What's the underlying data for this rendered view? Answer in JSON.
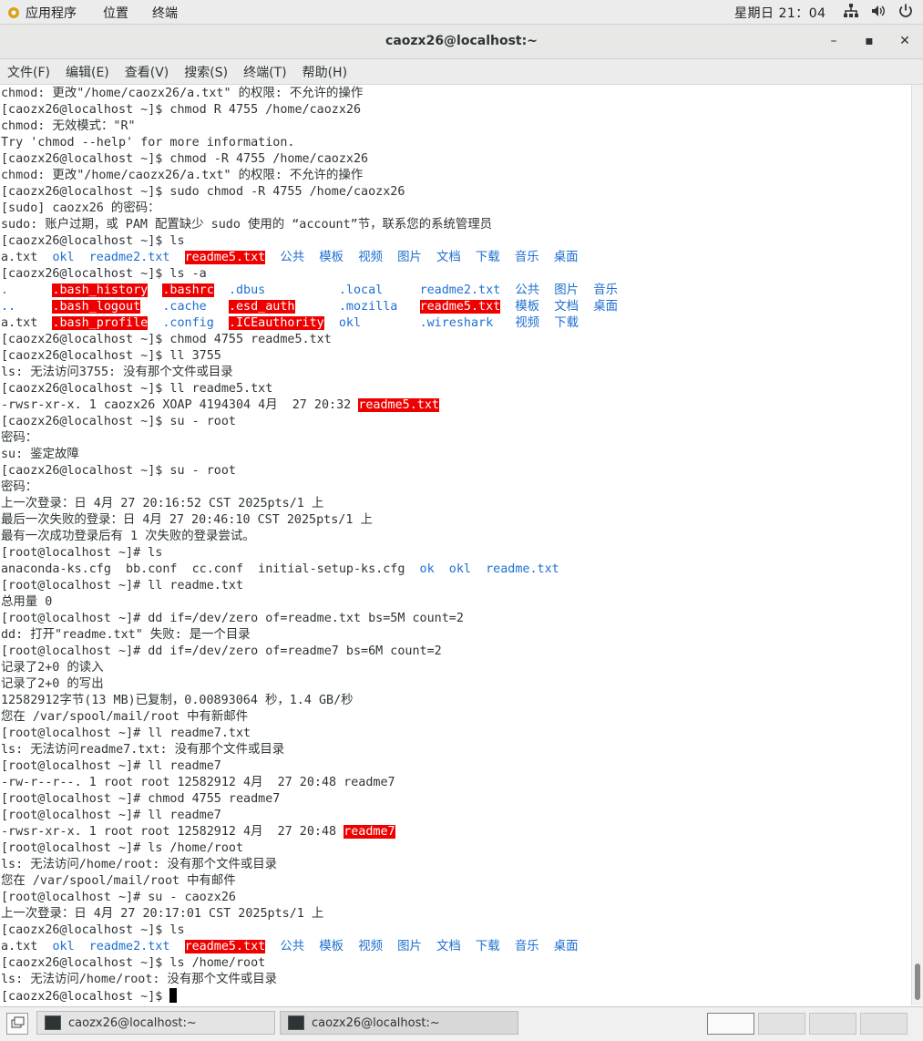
{
  "topbar": {
    "apps_label": "应用程序",
    "places_label": "位置",
    "terminal_label": "终端",
    "clock": "星期日 21：04"
  },
  "window": {
    "title": "caozx26@localhost:~",
    "minimize_glyph": "–",
    "maximize_glyph": "▪",
    "close_glyph": "✕"
  },
  "menu": {
    "file": "文件(F)",
    "edit": "编辑(E)",
    "view": "查看(V)",
    "search": "搜索(S)",
    "terminal": "终端(T)",
    "help": "帮助(H)"
  },
  "colors": {
    "highlight_red": "#ef0000",
    "dir_blue": "#1e6fd0",
    "text": "#2e3436"
  },
  "terminal_lines": [
    [
      {
        "t": "chmod: 更改\"/home/caozx26/a.txt\" 的权限: 不允许的操作"
      }
    ],
    [
      {
        "t": "[caozx26@localhost ~]$ chmod R 4755 /home/caozx26"
      }
    ],
    [
      {
        "t": "chmod: 无效模式：\"R\""
      }
    ],
    [
      {
        "t": "Try 'chmod --help' for more information."
      }
    ],
    [
      {
        "t": "[caozx26@localhost ~]$ chmod -R 4755 /home/caozx26"
      }
    ],
    [
      {
        "t": "chmod: 更改\"/home/caozx26/a.txt\" 的权限: 不允许的操作"
      }
    ],
    [
      {
        "t": "[caozx26@localhost ~]$ sudo chmod -R 4755 /home/caozx26"
      }
    ],
    [
      {
        "t": "[sudo] caozx26 的密码："
      }
    ],
    [
      {
        "t": "sudo: 账户过期，或 PAM 配置缺少 sudo 使用的 “account”节，联系您的系统管理员"
      }
    ],
    [
      {
        "t": "[caozx26@localhost ~]$ ls"
      }
    ],
    [
      {
        "t": "a.txt  "
      },
      {
        "t": "okl",
        "c": "b"
      },
      {
        "t": "  "
      },
      {
        "t": "readme2.txt",
        "c": "b"
      },
      {
        "t": "  "
      },
      {
        "t": "readme5.txt",
        "c": "r"
      },
      {
        "t": "  "
      },
      {
        "t": "公共",
        "c": "b"
      },
      {
        "t": "  "
      },
      {
        "t": "模板",
        "c": "b"
      },
      {
        "t": "  "
      },
      {
        "t": "视频",
        "c": "b"
      },
      {
        "t": "  "
      },
      {
        "t": "图片",
        "c": "b"
      },
      {
        "t": "  "
      },
      {
        "t": "文档",
        "c": "b"
      },
      {
        "t": "  "
      },
      {
        "t": "下载",
        "c": "b"
      },
      {
        "t": "  "
      },
      {
        "t": "音乐",
        "c": "b"
      },
      {
        "t": "  "
      },
      {
        "t": "桌面",
        "c": "b"
      }
    ],
    [
      {
        "t": "[caozx26@localhost ~]$ ls -a"
      }
    ],
    [
      {
        "t": ".",
        "c": "b"
      },
      {
        "t": "      "
      },
      {
        "t": ".bash_history",
        "c": "r"
      },
      {
        "t": "  "
      },
      {
        "t": ".bashrc",
        "c": "r"
      },
      {
        "t": "  "
      },
      {
        "t": ".dbus",
        "c": "b"
      },
      {
        "t": "          "
      },
      {
        "t": ".local",
        "c": "b"
      },
      {
        "t": "     "
      },
      {
        "t": "readme2.txt",
        "c": "b"
      },
      {
        "t": "  "
      },
      {
        "t": "公共",
        "c": "b"
      },
      {
        "t": "  "
      },
      {
        "t": "图片",
        "c": "b"
      },
      {
        "t": "  "
      },
      {
        "t": "音乐",
        "c": "b"
      }
    ],
    [
      {
        "t": "..",
        "c": "b"
      },
      {
        "t": "     "
      },
      {
        "t": ".bash_logout",
        "c": "r"
      },
      {
        "t": "   "
      },
      {
        "t": ".cache",
        "c": "b"
      },
      {
        "t": "   "
      },
      {
        "t": ".esd_auth",
        "c": "r"
      },
      {
        "t": "      "
      },
      {
        "t": ".mozilla",
        "c": "b"
      },
      {
        "t": "   "
      },
      {
        "t": "readme5.txt",
        "c": "r"
      },
      {
        "t": "  "
      },
      {
        "t": "模板",
        "c": "b"
      },
      {
        "t": "  "
      },
      {
        "t": "文档",
        "c": "b"
      },
      {
        "t": "  "
      },
      {
        "t": "桌面",
        "c": "b"
      }
    ],
    [
      {
        "t": "a.txt  "
      },
      {
        "t": ".bash_profile",
        "c": "r"
      },
      {
        "t": "  "
      },
      {
        "t": ".config",
        "c": "b"
      },
      {
        "t": "  "
      },
      {
        "t": ".ICEauthority",
        "c": "r"
      },
      {
        "t": "  "
      },
      {
        "t": "okl",
        "c": "b"
      },
      {
        "t": "        "
      },
      {
        "t": ".wireshark",
        "c": "b"
      },
      {
        "t": "   "
      },
      {
        "t": "视频",
        "c": "b"
      },
      {
        "t": "  "
      },
      {
        "t": "下载",
        "c": "b"
      }
    ],
    [
      {
        "t": "[caozx26@localhost ~]$ chmod 4755 readme5.txt"
      }
    ],
    [
      {
        "t": "[caozx26@localhost ~]$ ll 3755"
      }
    ],
    [
      {
        "t": "ls: 无法访问3755: 没有那个文件或目录"
      }
    ],
    [
      {
        "t": "[caozx26@localhost ~]$ ll readme5.txt"
      }
    ],
    [
      {
        "t": "-rwsr-xr-x. 1 caozx26 XOAP 4194304 4月  27 20:32 "
      },
      {
        "t": "readme5.txt",
        "c": "r"
      }
    ],
    [
      {
        "t": "[caozx26@localhost ~]$ su - root"
      }
    ],
    [
      {
        "t": "密码："
      }
    ],
    [
      {
        "t": "su: 鉴定故障"
      }
    ],
    [
      {
        "t": "[caozx26@localhost ~]$ su - root"
      }
    ],
    [
      {
        "t": "密码："
      }
    ],
    [
      {
        "t": "上一次登录：日 4月 27 20:16:52 CST 2025pts/1 上"
      }
    ],
    [
      {
        "t": "最后一次失败的登录：日 4月 27 20:46:10 CST 2025pts/1 上"
      }
    ],
    [
      {
        "t": "最有一次成功登录后有 1 次失败的登录尝试。"
      }
    ],
    [
      {
        "t": "[root@localhost ~]# ls"
      }
    ],
    [
      {
        "t": "anaconda-ks.cfg  bb.conf  cc.conf  initial-setup-ks.cfg  "
      },
      {
        "t": "ok",
        "c": "b"
      },
      {
        "t": "  "
      },
      {
        "t": "okl",
        "c": "b"
      },
      {
        "t": "  "
      },
      {
        "t": "readme.txt",
        "c": "b"
      }
    ],
    [
      {
        "t": "[root@localhost ~]# ll readme.txt"
      }
    ],
    [
      {
        "t": "总用量 0"
      }
    ],
    [
      {
        "t": "[root@localhost ~]# dd if=/dev/zero of=readme.txt bs=5M count=2"
      }
    ],
    [
      {
        "t": "dd: 打开\"readme.txt\" 失败: 是一个目录"
      }
    ],
    [
      {
        "t": "[root@localhost ~]# dd if=/dev/zero of=readme7 bs=6M count=2"
      }
    ],
    [
      {
        "t": "记录了2+0 的读入"
      }
    ],
    [
      {
        "t": "记录了2+0 的写出"
      }
    ],
    [
      {
        "t": "12582912字节(13 MB)已复制，0.00893064 秒，1.4 GB/秒"
      }
    ],
    [
      {
        "t": "您在 /var/spool/mail/root 中有新邮件"
      }
    ],
    [
      {
        "t": "[root@localhost ~]# ll readme7.txt"
      }
    ],
    [
      {
        "t": "ls: 无法访问readme7.txt: 没有那个文件或目录"
      }
    ],
    [
      {
        "t": "[root@localhost ~]# ll readme7"
      }
    ],
    [
      {
        "t": "-rw-r--r--. 1 root root 12582912 4月  27 20:48 readme7"
      }
    ],
    [
      {
        "t": "[root@localhost ~]# chmod 4755 readme7"
      }
    ],
    [
      {
        "t": "[root@localhost ~]# ll readme7"
      }
    ],
    [
      {
        "t": "-rwsr-xr-x. 1 root root 12582912 4月  27 20:48 "
      },
      {
        "t": "readme7",
        "c": "r"
      }
    ],
    [
      {
        "t": "[root@localhost ~]# ls /home/root"
      }
    ],
    [
      {
        "t": "ls: 无法访问/home/root: 没有那个文件或目录"
      }
    ],
    [
      {
        "t": "您在 /var/spool/mail/root 中有邮件"
      }
    ],
    [
      {
        "t": "[root@localhost ~]# su - caozx26"
      }
    ],
    [
      {
        "t": "上一次登录：日 4月 27 20:17:01 CST 2025pts/1 上"
      }
    ],
    [
      {
        "t": "[caozx26@localhost ~]$ ls"
      }
    ],
    [
      {
        "t": "a.txt  "
      },
      {
        "t": "okl",
        "c": "b"
      },
      {
        "t": "  "
      },
      {
        "t": "readme2.txt",
        "c": "b"
      },
      {
        "t": "  "
      },
      {
        "t": "readme5.txt",
        "c": "r"
      },
      {
        "t": "  "
      },
      {
        "t": "公共",
        "c": "b"
      },
      {
        "t": "  "
      },
      {
        "t": "模板",
        "c": "b"
      },
      {
        "t": "  "
      },
      {
        "t": "视频",
        "c": "b"
      },
      {
        "t": "  "
      },
      {
        "t": "图片",
        "c": "b"
      },
      {
        "t": "  "
      },
      {
        "t": "文档",
        "c": "b"
      },
      {
        "t": "  "
      },
      {
        "t": "下载",
        "c": "b"
      },
      {
        "t": "  "
      },
      {
        "t": "音乐",
        "c": "b"
      },
      {
        "t": "  "
      },
      {
        "t": "桌面",
        "c": "b"
      }
    ],
    [
      {
        "t": "[caozx26@localhost ~]$ ls /home/root"
      }
    ],
    [
      {
        "t": "ls: 无法访问/home/root: 没有那个文件或目录"
      }
    ],
    [
      {
        "t": "[caozx26@localhost ~]$ "
      },
      {
        "t": "",
        "c": "cursor"
      }
    ]
  ],
  "taskbar": {
    "tasks": [
      {
        "label": "caozx26@localhost:~"
      },
      {
        "label": "caozx26@localhost:~"
      }
    ],
    "workspaces": 4,
    "active_workspace": 1
  }
}
